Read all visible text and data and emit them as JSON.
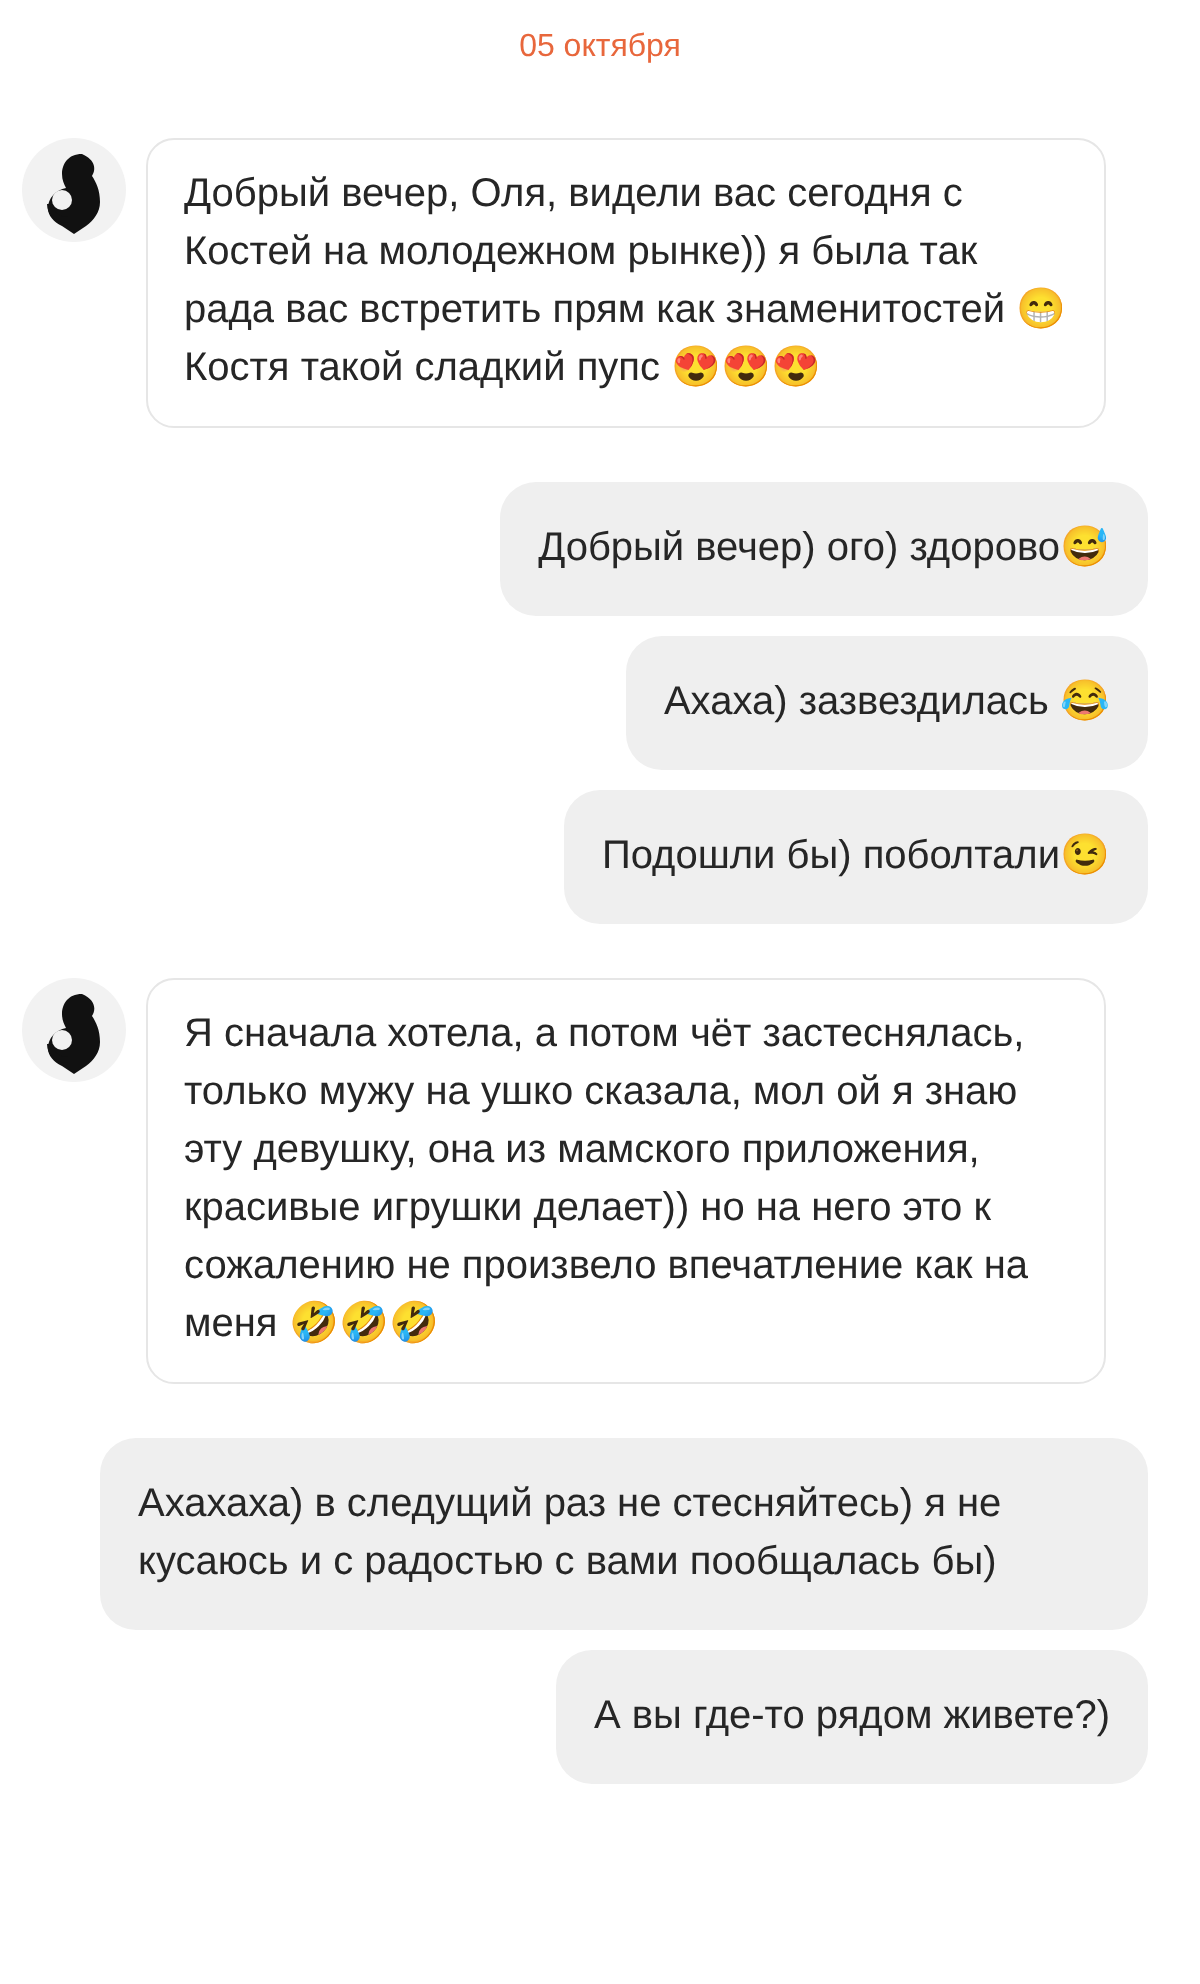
{
  "date": "05 октября",
  "messages": [
    {
      "kind": "incoming",
      "text": "Добрый вечер, Оля, видели вас сегодня с Костей на молодежном рынке)) я была так рада вас встретить прям как знаменитостей 😁Костя такой сладкий пупс 😍😍😍"
    },
    {
      "kind": "outgoing",
      "text": "Добрый вечер) ого) здорово😅"
    },
    {
      "kind": "outgoing",
      "text": "Ахаха) зазвездилась 😂"
    },
    {
      "kind": "outgoing",
      "text": "Подошли бы) поболтали😉"
    },
    {
      "kind": "incoming",
      "text": "Я сначала хотела, а потом чёт застеснялась, только мужу на ушко сказала, мол ой я знаю эту девушку, она из мамского приложения, красивые игрушки делает)) но на него это к сожалению не произвело впечатление как на меня 🤣🤣🤣"
    },
    {
      "kind": "outgoing",
      "text": "Ахахаха) в следущий раз не стесняйтесь) я не кусаюсь и с радостью с вами пообщалась бы)"
    },
    {
      "kind": "outgoing",
      "text": "А вы где-то рядом живете?)"
    }
  ]
}
